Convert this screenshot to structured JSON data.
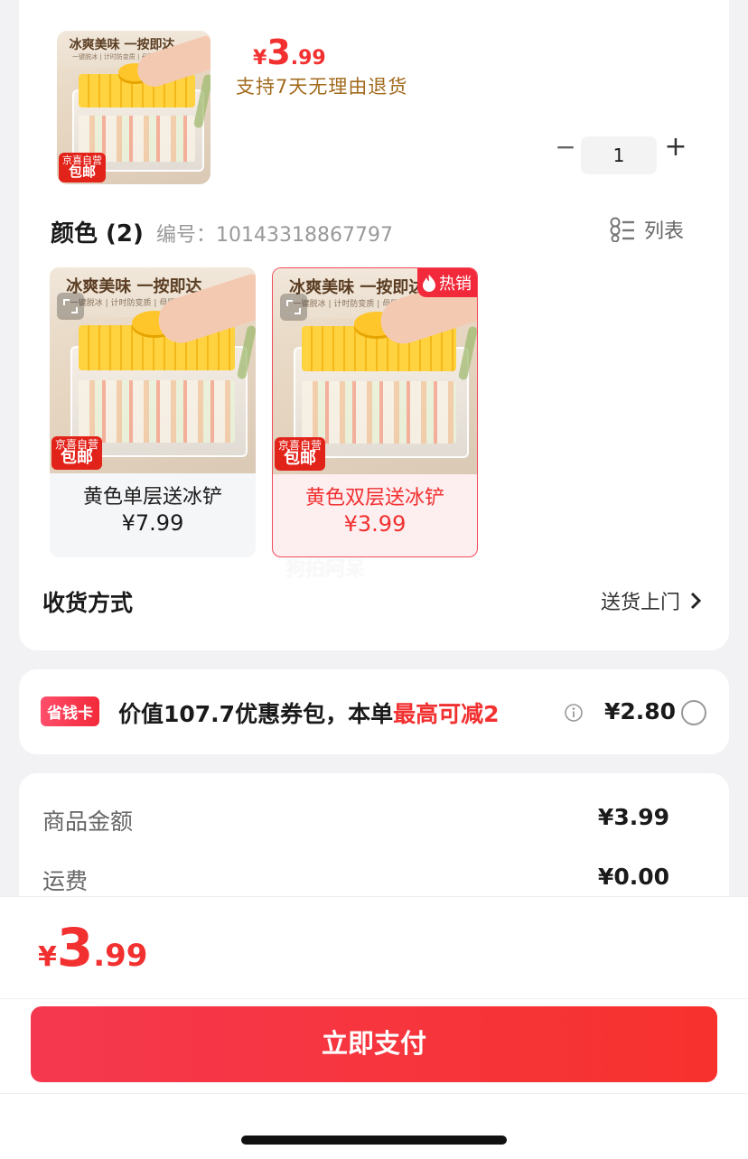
{
  "product": {
    "thumb_title": "冰爽美味 一按即达",
    "thumb_sub": "一键脱冰 | 计时防变质 | 母婴材质",
    "badge_line1": "京喜自营",
    "badge_line2": "包邮",
    "price_currency": "¥",
    "price_int": "3",
    "price_dec": ".99",
    "return_note": "支持7天无理由退货",
    "quantity": "1"
  },
  "color_section": {
    "title": "颜色 (2)",
    "code": "编号：10143318867797",
    "list_label": "列表"
  },
  "options": [
    {
      "img_title": "冰爽美味 一按即达",
      "img_sub": "一键脱冰 | 计时防变质 | 母婴材质",
      "badge_line1": "京喜自营",
      "badge_line2": "包邮",
      "name": "黄色单层送冰铲",
      "price": "¥7.99"
    },
    {
      "img_title": "冰爽美味 一按即达",
      "img_sub": "一键脱冰 | 计时防变质 | 母婴材质",
      "badge_line1": "京喜自营",
      "badge_line2": "包邮",
      "name": "黄色双层送冰铲",
      "price": "¥3.99",
      "hot_tag": "热销",
      "selected": true
    }
  ],
  "watermark": "狗拍阿呆",
  "delivery": {
    "label": "收货方式",
    "value": "送货上门"
  },
  "coupon": {
    "badge": "省钱卡",
    "text_prefix": "价值107.7优惠券包，本单",
    "text_highlight": "最高可减2",
    "amount": "¥2.80"
  },
  "summary": {
    "rows": [
      {
        "label": "商品金额",
        "value": "¥3.99"
      },
      {
        "label": "运费",
        "value": "¥0.00"
      }
    ]
  },
  "footer": {
    "total_currency": "¥",
    "total_int": "3",
    "total_dec": ".99",
    "pay_label": "立即支付"
  },
  "colors": {
    "accent_red": "#f23030",
    "return_note": "#a26b1e",
    "pay_button": "#f5384f"
  }
}
